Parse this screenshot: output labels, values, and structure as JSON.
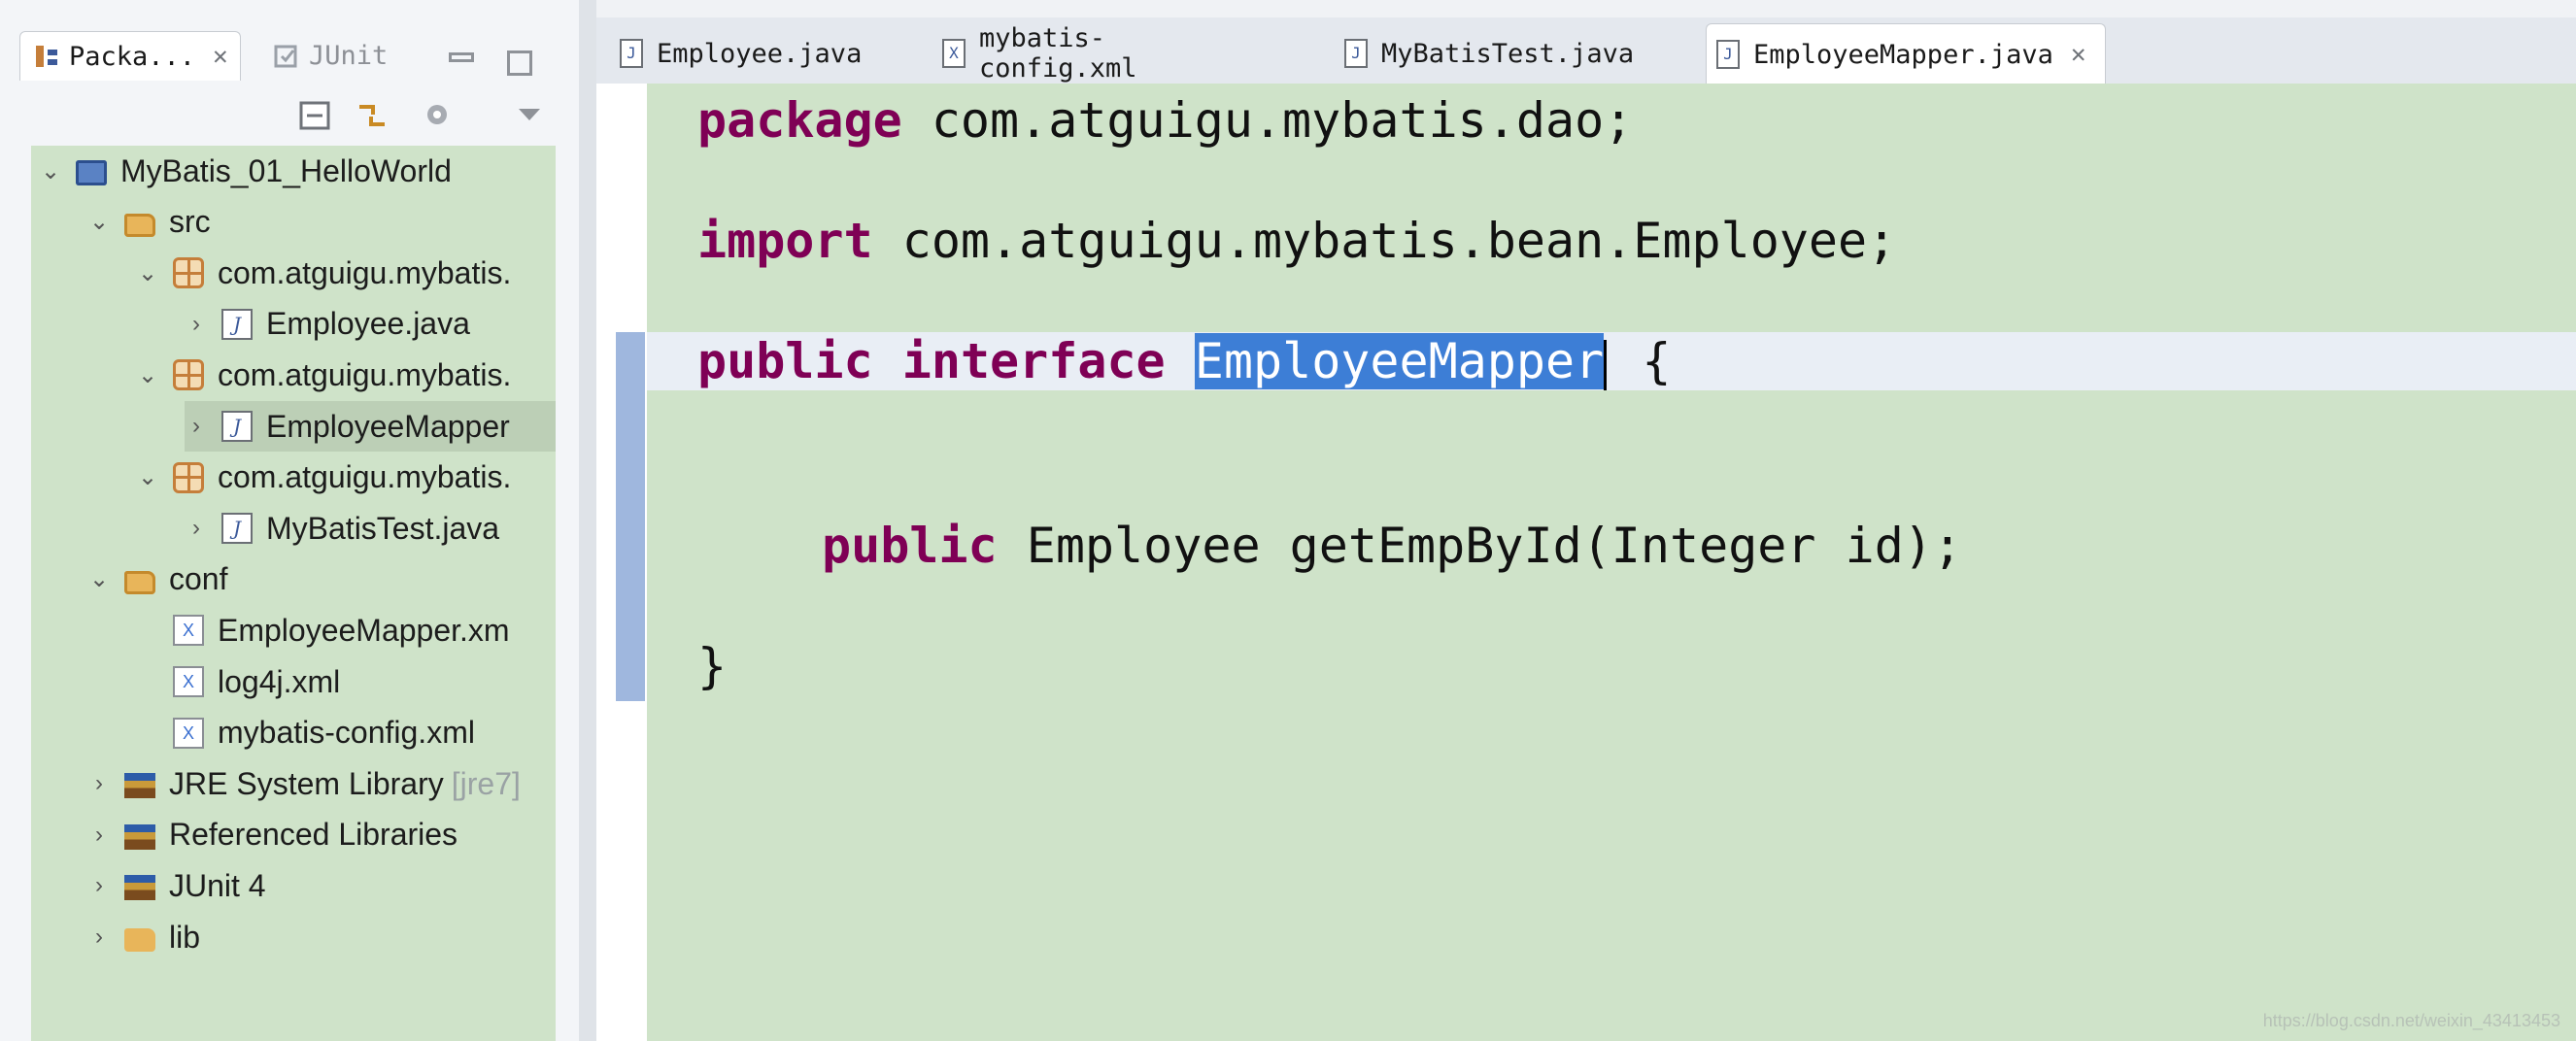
{
  "explorer": {
    "tabs": [
      {
        "label": "Packa...",
        "icon": "package-explorer-icon",
        "active": true
      },
      {
        "label": "JUnit",
        "icon": "junit-icon",
        "active": false
      }
    ],
    "tree": [
      {
        "label": "MyBatis_01_HelloWorld",
        "icon": "project-icon",
        "twisty": "⌄",
        "depth": 0
      },
      {
        "label": "src",
        "icon": "source-folder-icon",
        "twisty": "⌄",
        "depth": 1
      },
      {
        "label": "com.atguigu.mybatis.",
        "icon": "package-icon",
        "twisty": "⌄",
        "depth": 2
      },
      {
        "label": "Employee.java",
        "icon": "java-file-icon",
        "twisty": "›",
        "depth": 3
      },
      {
        "label": "com.atguigu.mybatis.",
        "icon": "package-icon",
        "twisty": "⌄",
        "depth": 2
      },
      {
        "label": "EmployeeMapper",
        "icon": "java-file-icon",
        "twisty": "›",
        "depth": 3,
        "selected": true
      },
      {
        "label": "com.atguigu.mybatis.",
        "icon": "package-icon",
        "twisty": "⌄",
        "depth": 2
      },
      {
        "label": "MyBatisTest.java",
        "icon": "java-file-icon",
        "twisty": "›",
        "depth": 3
      },
      {
        "label": "conf",
        "icon": "source-folder-icon",
        "twisty": "⌄",
        "depth": 1
      },
      {
        "label": "EmployeeMapper.xm",
        "icon": "xml-file-icon",
        "twisty": "",
        "depth": 2
      },
      {
        "label": "log4j.xml",
        "icon": "xml-file-icon",
        "twisty": "",
        "depth": 2
      },
      {
        "label": "mybatis-config.xml",
        "icon": "xml-file-icon",
        "twisty": "",
        "depth": 2
      },
      {
        "label": "JRE System Library",
        "icon": "library-icon",
        "twisty": "›",
        "depth": 1,
        "decor": "[jre7]"
      },
      {
        "label": "Referenced Libraries",
        "icon": "library-icon",
        "twisty": "›",
        "depth": 1
      },
      {
        "label": "JUnit 4",
        "icon": "library-icon",
        "twisty": "›",
        "depth": 1
      },
      {
        "label": "lib",
        "icon": "folder-icon",
        "twisty": "›",
        "depth": 1
      }
    ]
  },
  "editor": {
    "tabs": [
      {
        "label": "Employee.java",
        "icon": "J",
        "active": false
      },
      {
        "label": "mybatis-config.xml",
        "icon": "X",
        "active": false
      },
      {
        "label": "MyBatisTest.java",
        "icon": "J",
        "active": false
      },
      {
        "label": "EmployeeMapper.java",
        "icon": "J",
        "active": true
      }
    ],
    "code": {
      "line1_kw": "package",
      "line1_rest": " com.atguigu.mybatis.dao;",
      "line2_kw": "import",
      "line2_rest": " com.atguigu.mybatis.bean.Employee;",
      "line3_kw1": "public",
      "line3_kw2": "interface",
      "line3_selected": "EmployeeMapper",
      "line3_rest": "{",
      "line4_kw": "public",
      "line4_rest": " Employee getEmpById(Integer id);",
      "line5": "}"
    }
  },
  "watermark": "https://blog.csdn.net/weixin_43413453"
}
